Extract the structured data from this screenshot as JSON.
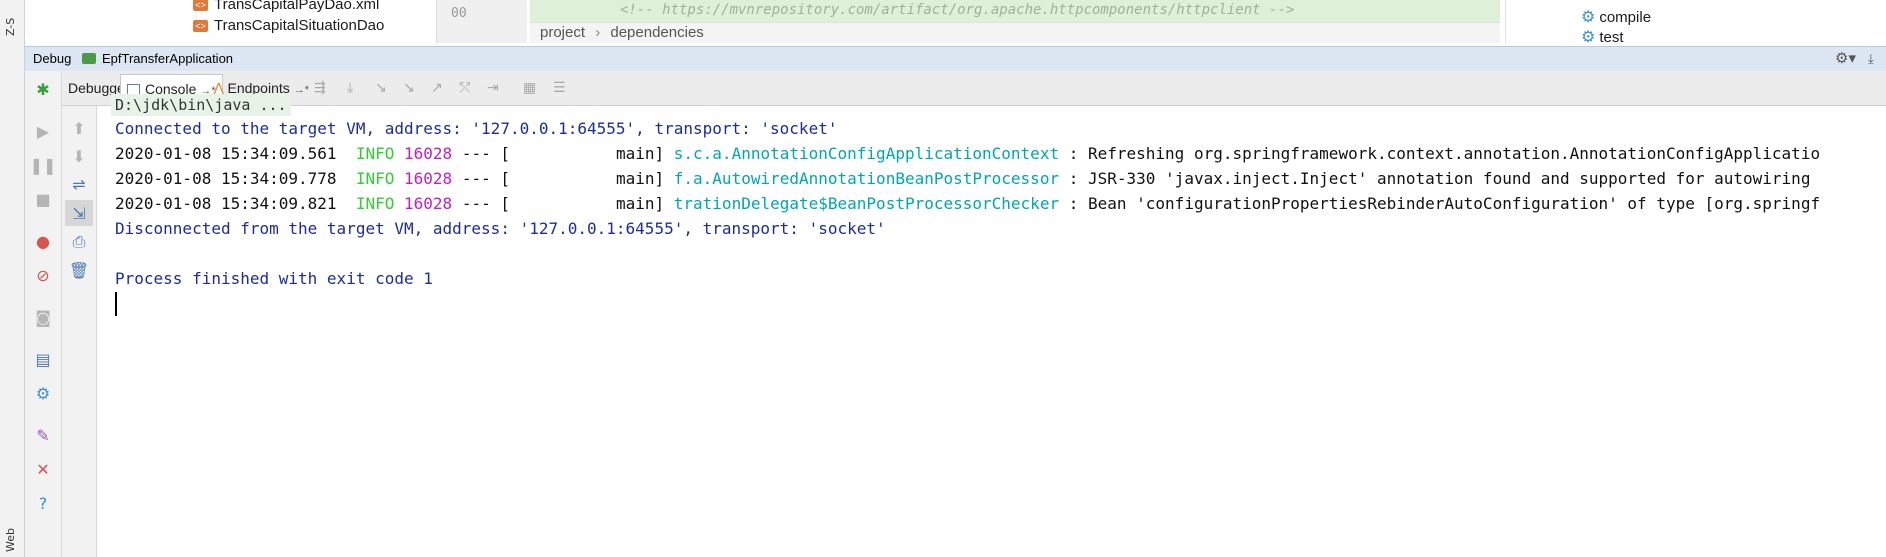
{
  "left_strip": {
    "top_label": "Z-S",
    "bottom_label": "Web"
  },
  "file_tree": {
    "items": [
      "TransCapitalPayDao.xml",
      "TransCapitalSituationDao"
    ]
  },
  "editor": {
    "line_number": "00",
    "code_snippet": "<!-- https://mvnrepository.com/artifact/org.apache.httpcomponents/httpclient -->",
    "breadcrumb": [
      "project",
      "dependencies"
    ],
    "breadcrumb_separator": "›"
  },
  "maven_tree": {
    "items": [
      "compile",
      "test"
    ]
  },
  "debug_bar": {
    "label": "Debug",
    "config_name": "EpfTransferApplication"
  },
  "tabs": {
    "debugger": "Debugger",
    "console": "Console",
    "console_pin": "→*",
    "endpoints": "Endpoints",
    "endpoints_pin": "→*"
  },
  "console": {
    "command": "D:\\jdk\\bin\\java ...",
    "connected": "Connected to the target VM, address: '127.0.0.1:64555', transport: 'socket'",
    "logs": [
      {
        "time": "2020-01-08 15:34:09.561",
        "level": "INFO",
        "pid": "16028",
        "sep": "--- [",
        "thread": "main]",
        "class": "s.c.a.AnnotationConfigApplicationContext",
        "message": ": Refreshing org.springframework.context.annotation.AnnotationConfigApplicatio"
      },
      {
        "time": "2020-01-08 15:34:09.778",
        "level": "INFO",
        "pid": "16028",
        "sep": "--- [",
        "thread": "main]",
        "class": "f.a.AutowiredAnnotationBeanPostProcessor",
        "message": ": JSR-330 'javax.inject.Inject' annotation found and supported for autowiring"
      },
      {
        "time": "2020-01-08 15:34:09.821",
        "level": "INFO",
        "pid": "16028",
        "sep": "--- [",
        "thread": "main]",
        "class": "trationDelegate$BeanPostProcessorChecker",
        "message": ": Bean 'configurationPropertiesRebinderAutoConfiguration' of type [org.springf"
      }
    ],
    "disconnected": "Disconnected from the target VM, address: '127.0.0.1:64555', transport: 'socket'",
    "finished": "Process finished with exit code 1"
  },
  "colors": {
    "info": "#33cc33",
    "pid": "#c11fc1",
    "class": "#00a6b0",
    "system": "#1c2c9a"
  }
}
